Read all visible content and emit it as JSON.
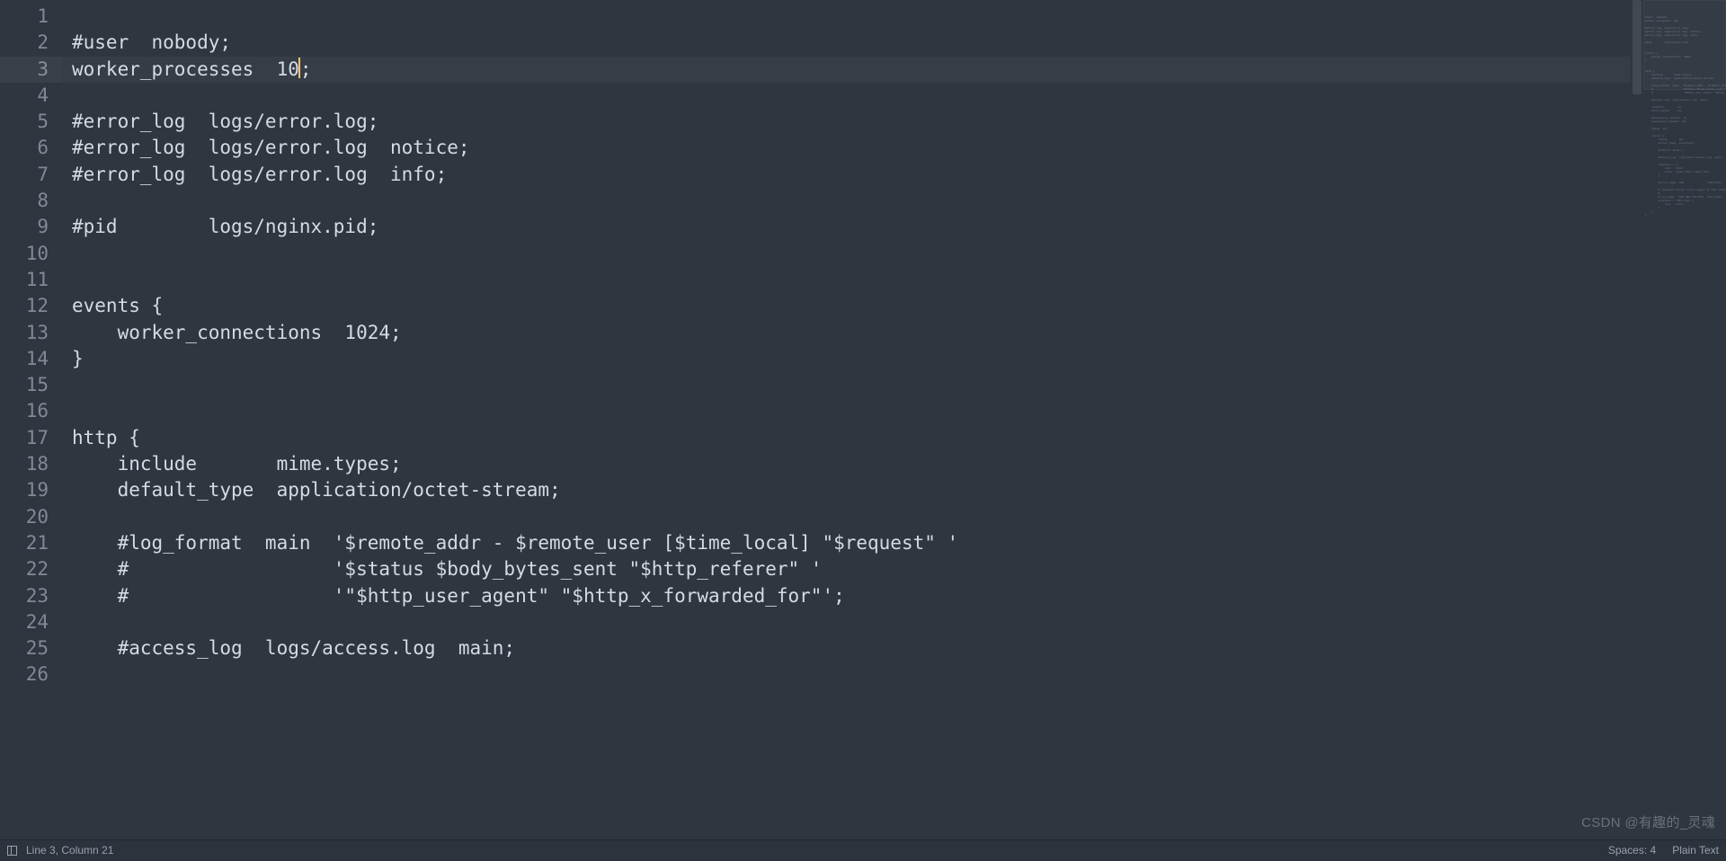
{
  "cursor_line_index": 2,
  "code_lines": [
    "",
    "#user  nobody;",
    "worker_processes  10;",
    "",
    "#error_log  logs/error.log;",
    "#error_log  logs/error.log  notice;",
    "#error_log  logs/error.log  info;",
    "",
    "#pid        logs/nginx.pid;",
    "",
    "",
    "events {",
    "    worker_connections  1024;",
    "}",
    "",
    "",
    "http {",
    "    include       mime.types;",
    "    default_type  application/octet-stream;",
    "",
    "    #log_format  main  '$remote_addr - $remote_user [$time_local] \"$request\" '",
    "    #                  '$status $body_bytes_sent \"$http_referer\" '",
    "    #                  '\"$http_user_agent\" \"$http_x_forwarded_for\"';",
    "",
    "    #access_log  logs/access.log  main;",
    ""
  ],
  "cursor_after_col": 20,
  "statusbar": {
    "position": "Line 3, Column 21",
    "spaces": "Spaces: 4",
    "syntax": "Plain Text"
  },
  "watermark": "CSDN @有趣的_灵魂",
  "minimap_lines": [
    "",
    "#user  nobody;",
    "worker_processes  10;",
    "",
    "#error_log  logs/error.log;",
    "#error_log  logs/error.log  notice;",
    "#error_log  logs/error.log  info;",
    "",
    "#pid        logs/nginx.pid;",
    "",
    "",
    "events {",
    "    worker_connections  1024;",
    "}",
    "",
    "",
    "http {",
    "    include       mime.types;",
    "    default_type  application/octet-stream;",
    "",
    "    #log_format  main  '$remote_addr - $remote_user [$time_local] \"$request\" '",
    "    #                  '$status $body_bytes_sent \"$http_referer\" '",
    "    #                  '\"$http_user_agent\" \"$http_x_forwarded_for\"';",
    "",
    "    #access_log  logs/access.log  main;",
    "",
    "    sendfile        on;",
    "    #tcp_nopush     on;",
    "",
    "    #keepalive_timeout  0;",
    "    keepalive_timeout  65;",
    "",
    "    #gzip  on;",
    "",
    "    server {",
    "        listen       80;",
    "        server_name  localhost;",
    "",
    "        #charset koi8-r;",
    "",
    "        #access_log  logs/host.access.log  main;",
    "",
    "        location / {",
    "            root   html;",
    "            index  index.html index.htm;",
    "        }",
    "",
    "        #error_page  404              /404.html;",
    "",
    "        # redirect server error pages to the static page /50x.html",
    "        #",
    "        error_page   500 502 503 504  /50x.html;",
    "        location = /50x.html {",
    "            root   html;",
    "        }",
    "    }",
    "}"
  ]
}
